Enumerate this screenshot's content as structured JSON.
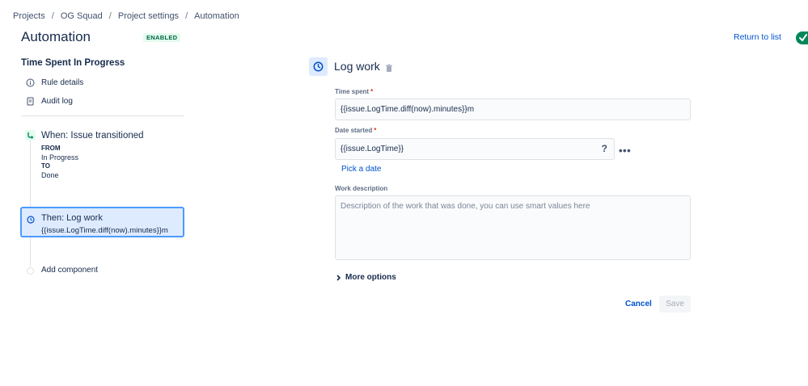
{
  "breadcrumb": [
    {
      "label": "Projects"
    },
    {
      "label": "OG Squad"
    },
    {
      "label": "Project settings"
    },
    {
      "label": "Automation"
    }
  ],
  "breadcrumb_separator": "/",
  "header": {
    "title": "Automation",
    "status_lozenge": "ENABLED",
    "return_link": "Return to list",
    "toggle_checked": true,
    "toggle_icon": "check-icon"
  },
  "sidebar": {
    "rule_name": "Time Spent In Progress",
    "links": [
      {
        "label": "Rule details",
        "icon": "info-icon"
      },
      {
        "label": "Audit log",
        "icon": "document-icon"
      }
    ],
    "trigger": {
      "title": "When: Issue transitioned",
      "from_label": "FROM",
      "from_value": "In Progress",
      "to_label": "TO",
      "to_value": "Done",
      "icon": "branch-icon"
    },
    "action": {
      "title": "Then: Log work",
      "subtitle": "{{issue.LogTime.diff(now).minutes}}m",
      "icon": "clock-icon",
      "selected": true
    },
    "add_component": "Add component"
  },
  "panel": {
    "title": "Log work",
    "icon": "clock-icon",
    "delete_icon": "trash-icon",
    "time_spent": {
      "label": "Time spent",
      "required_mark": "*",
      "value": "{{issue.LogTime.diff(now).minutes}}m"
    },
    "date_started": {
      "label": "Date started",
      "required_mark": "*",
      "value": "{{issue.LogTime}}",
      "help": "?",
      "more": "•••"
    },
    "pick_date": "Pick a date",
    "work_description": {
      "label": "Work description",
      "placeholder": "Description of the work that was done, you can use smart values here"
    },
    "more_options": "More options",
    "cancel": "Cancel",
    "save": "Save"
  },
  "colors": {
    "accent": "#0052cc",
    "toggle_on": "#00875a",
    "lozenge_bg": "#e3fcef",
    "lozenge_text": "#006644",
    "selected_border": "#4c9aff",
    "required": "#de350b"
  }
}
